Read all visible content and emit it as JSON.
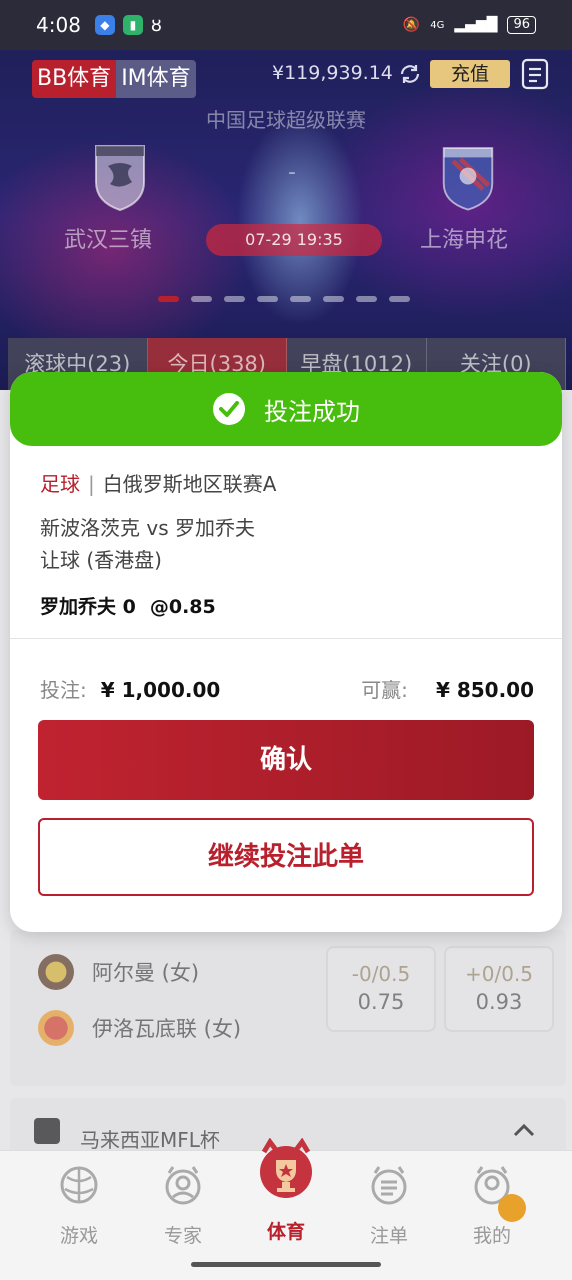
{
  "status_bar": {
    "time": "4:08",
    "signal": "4G",
    "battery": "96"
  },
  "header": {
    "vendor_tabs": [
      "BB体育",
      "IM体育"
    ],
    "balance": "¥119,939.14",
    "recharge_label": "充值"
  },
  "banner": {
    "league": "中国足球超级联赛",
    "home_team": "武汉三镇",
    "away_team": "上海申花",
    "score_separator": "-",
    "kickoff": "07-29  19:35",
    "slide_count": 8,
    "active_slide": 0
  },
  "filter_tabs": [
    "滚球中(23)",
    "今日(338)",
    "早盘(1012)",
    "关注(0)"
  ],
  "match": {
    "home": "阿尔曼 (女)",
    "away": "伊洛瓦底联 (女)",
    "odds": [
      {
        "handicap": "-0/0.5",
        "odds": "0.75"
      },
      {
        "handicap": "+0/0.5",
        "odds": "0.93"
      }
    ]
  },
  "next_league": "马来西亚MFL杯",
  "bottom_nav": [
    "游戏",
    "专家",
    "体育",
    "注单",
    "我的"
  ],
  "modal": {
    "title": "投注成功",
    "sport": "足球",
    "separator": "|",
    "league": "白俄罗斯地区联赛A",
    "match": "新波洛茨克 vs 罗加乔夫",
    "market": "让球 (香港盘)",
    "pick": "罗加乔夫 0",
    "pick_odds": "@0.85",
    "stake_label": "投注:",
    "stake": "¥ 1,000.00",
    "win_label": "可赢:",
    "win": "¥ 850.00",
    "confirm": "确认",
    "continue": "继续投注此单"
  },
  "colors": {
    "accent": "#b8202d",
    "success": "#47be0d",
    "gold": "#e6c77d"
  }
}
